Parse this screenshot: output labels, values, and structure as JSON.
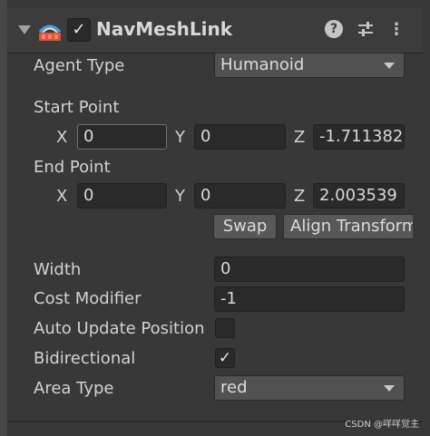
{
  "component": {
    "title": "NavMeshLink",
    "enabled": "✓",
    "icons": {
      "foldout": "foldout-arrow-icon",
      "component": "navmeshlink-icon",
      "help": "help-icon",
      "preset": "preset-sliders-icon",
      "more": "more-vertical-icon"
    }
  },
  "agent_type": {
    "label": "Agent Type",
    "value": "Humanoid"
  },
  "start_point": {
    "label": "Start Point",
    "x_label": "X",
    "x": "0",
    "y_label": "Y",
    "y": "0",
    "z_label": "Z",
    "z": "-1.711382"
  },
  "end_point": {
    "label": "End Point",
    "x_label": "X",
    "x": "0",
    "y_label": "Y",
    "y": "0",
    "z_label": "Z",
    "z": "2.003539"
  },
  "buttons": {
    "swap": "Swap",
    "align_transform": "Align Transform"
  },
  "width": {
    "label": "Width",
    "value": "0"
  },
  "cost_modifier": {
    "label": "Cost Modifier",
    "value": "-1"
  },
  "auto_update_position": {
    "label": "Auto Update Position",
    "checked": ""
  },
  "bidirectional": {
    "label": "Bidirectional",
    "checked": "✓"
  },
  "area_type": {
    "label": "Area Type",
    "value": "red"
  },
  "watermark": "CSDN @咩咩觉主"
}
